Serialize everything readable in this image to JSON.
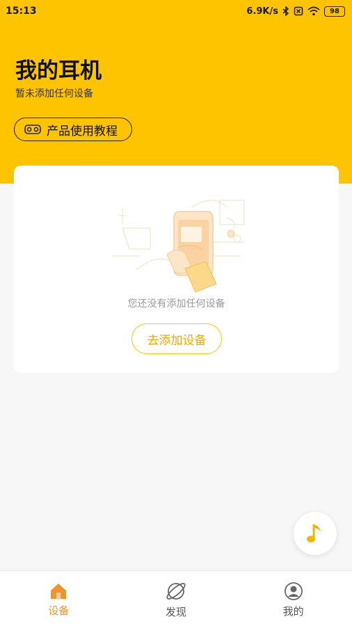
{
  "status_bar": {
    "time": "15:13",
    "network_speed": "6.9K/s",
    "battery": "98"
  },
  "header": {
    "title": "我的耳机",
    "subtitle": "暂未添加任何设备",
    "tutorial_label": "产品使用教程"
  },
  "empty_state": {
    "message": "您还没有添加任何设备",
    "add_button_label": "去添加设备"
  },
  "bottom_nav": {
    "items": [
      {
        "label": "设备",
        "icon": "home-icon",
        "active": true
      },
      {
        "label": "发现",
        "icon": "planet-icon",
        "active": false
      },
      {
        "label": "我的",
        "icon": "profile-icon",
        "active": false
      }
    ]
  },
  "colors": {
    "brand_yellow": "#fec400",
    "accent_orange": "#f0952e",
    "background": "#f7f7f7"
  }
}
